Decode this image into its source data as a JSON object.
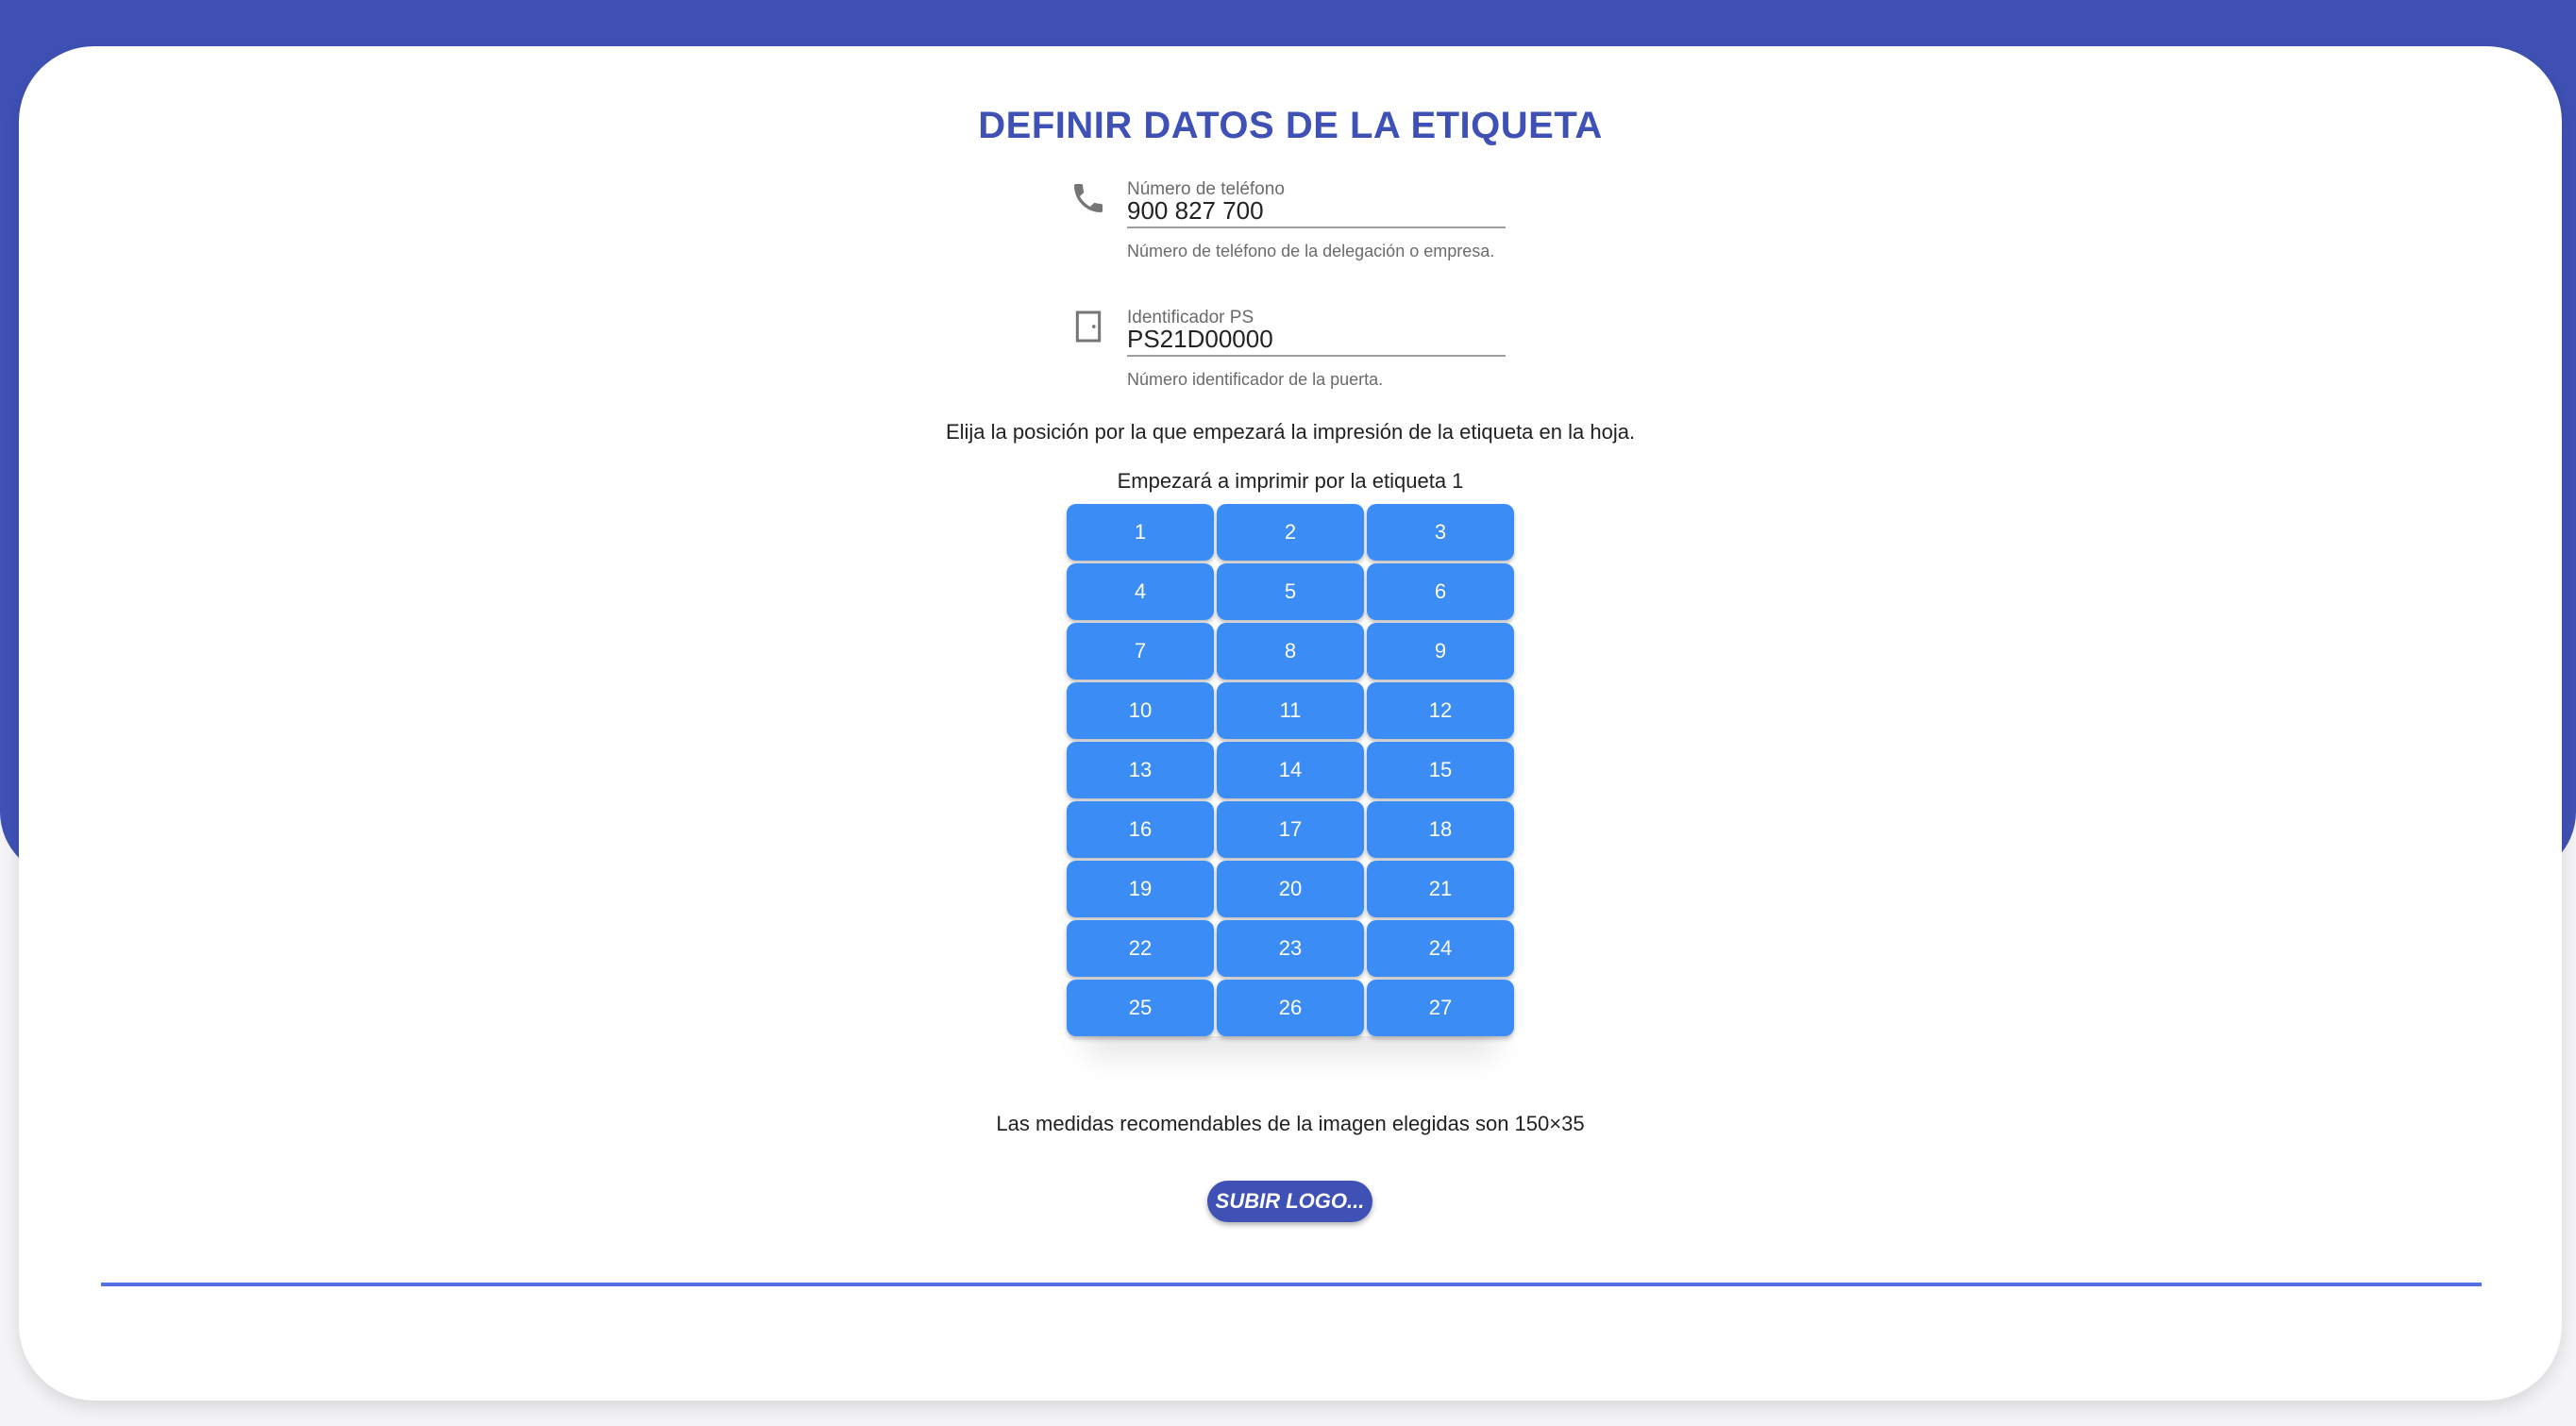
{
  "colors": {
    "primary": "#3f51b5",
    "cell": "#3b8cf5",
    "divider": "#536ee6"
  },
  "title": "DEFINIR DATOS DE LA ETIQUETA",
  "phone": {
    "icon": "phone-icon",
    "label": "Número de teléfono",
    "value": "900 827 700",
    "hint": "Número de teléfono de la delegación o empresa."
  },
  "ps": {
    "icon": "door-icon",
    "label": "Identificador PS",
    "value": "PS21D00000",
    "hint": "Número identificador de la puerta."
  },
  "instruction": "Elija la posición por la que empezará la impresión de la etiqueta en la hoja.",
  "start_text": "Empezará a imprimir por la etiqueta 1",
  "positions": [
    "1",
    "2",
    "3",
    "4",
    "5",
    "6",
    "7",
    "8",
    "9",
    "10",
    "11",
    "12",
    "13",
    "14",
    "15",
    "16",
    "17",
    "18",
    "19",
    "20",
    "21",
    "22",
    "23",
    "24",
    "25",
    "26",
    "27"
  ],
  "recommend": "Las medidas recomendables de la imagen elegidas son 150×35",
  "upload_label": "SUBIR LOGO..."
}
